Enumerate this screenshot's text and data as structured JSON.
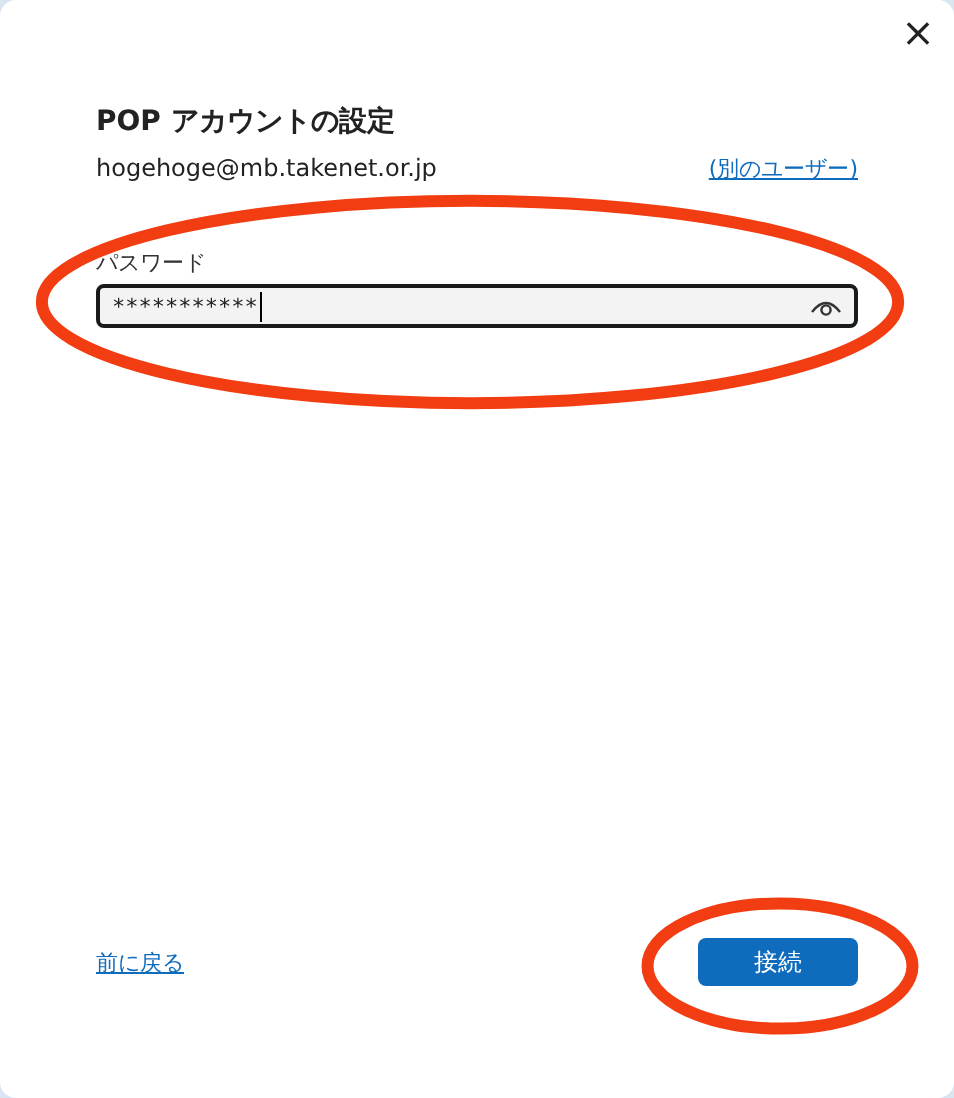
{
  "dialog": {
    "close": "×"
  },
  "title": "POP アカウントの設定",
  "account": {
    "email": "hogehoge@mb.takenet.or.jp",
    "switch_link": "(別のユーザー)"
  },
  "password": {
    "label": "パスワード",
    "value": "***********",
    "highlighted": true
  },
  "back_link": "前に戻る",
  "connect_button": {
    "label": "接続",
    "highlighted": true
  }
}
